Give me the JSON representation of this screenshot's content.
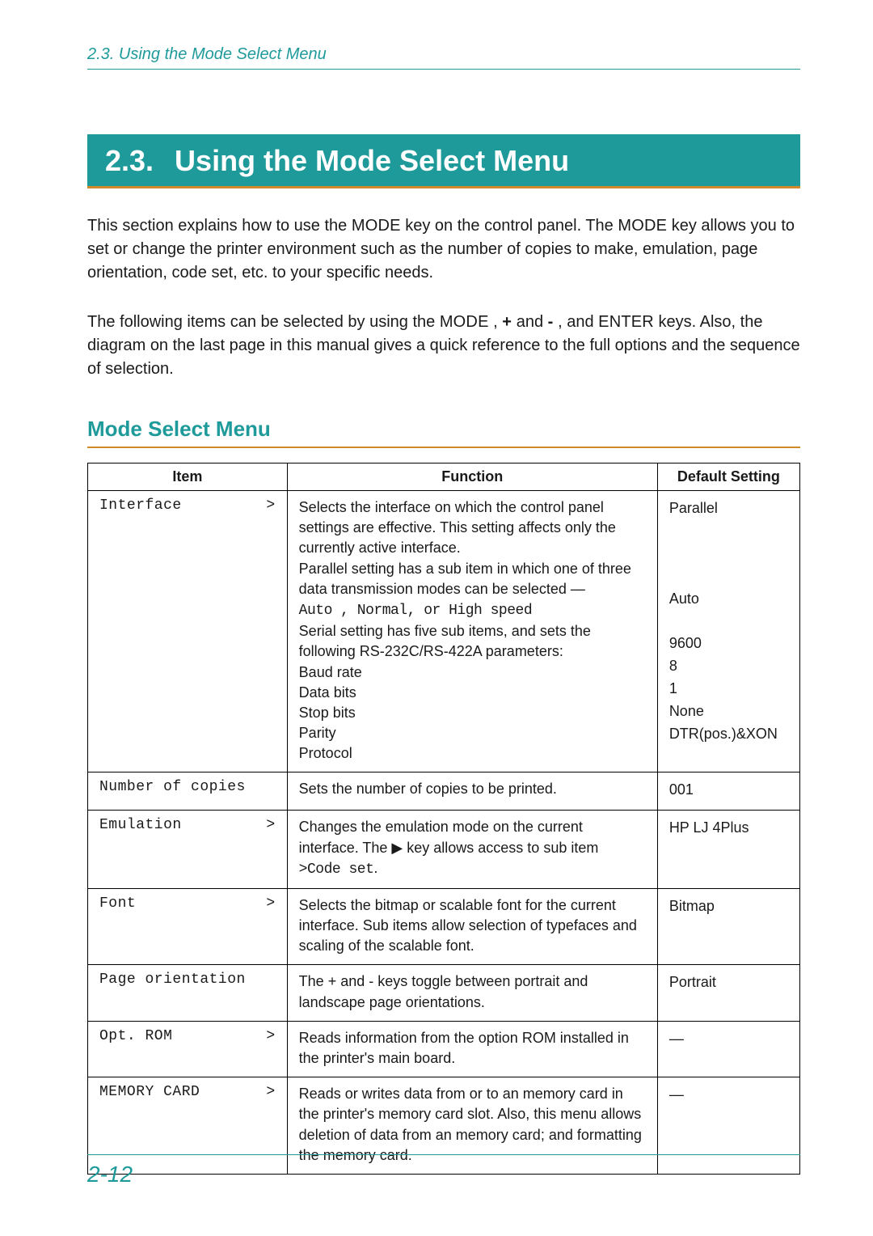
{
  "header": {
    "running_head": "2.3.  Using the Mode Select Menu"
  },
  "chapter": {
    "number": "2.3.",
    "title": "Using the Mode Select Menu"
  },
  "paragraphs": {
    "p1_a": "This section explains how to use the ",
    "p1_key1": "MODE",
    "p1_b": " key on the control panel. The ",
    "p1_key2": "MODE",
    "p1_c": " key allows you to set or change the printer environment such as the number of copies to make, emulation, page orientation, code set, etc. to your specific needs.",
    "p2_a": "The following items can be selected by using the ",
    "p2_key1": "MODE",
    "p2_b": " , ",
    "p2_key2": "+",
    "p2_c": " and ",
    "p2_key3": "-",
    "p2_d": " , and ",
    "p2_key4": "ENTER",
    "p2_e": " keys. Also, the diagram on the last page in this manual gives a quick reference to the full options and the sequence of selection."
  },
  "subheading": "Mode Select Menu",
  "table": {
    "headers": {
      "c1": "Item",
      "c2": "Function",
      "c3": "Default Setting"
    },
    "rows": [
      {
        "item": "Interface",
        "arrow": ">",
        "func_a": "Selects the interface on which the control panel settings are effective. This setting affects only the currently active interface.\nParallel setting has a sub item in which one of three data transmission modes can be selected —",
        "func_mono": "Auto , Normal, or High speed",
        "func_b": "\nSerial setting has five sub items, and sets the following RS-232C/RS-422A parameters:\nBaud rate\nData bits\nStop bits\nParity\nProtocol",
        "def": "Parallel\n\n\n\nAuto\n\n9600\n8\n1\nNone\nDTR(pos.)&XON"
      },
      {
        "item": "Number of copies",
        "arrow": "",
        "func_a": "Sets the number of copies to be printed.",
        "func_mono": "",
        "func_b": "",
        "def": "001"
      },
      {
        "item": "Emulation",
        "arrow": ">",
        "func_a": "Changes the emulation mode on the current interface. The ▶ key allows access to sub item",
        "func_mono": ">Code set",
        "func_b": ".",
        "def": "HP LJ 4Plus"
      },
      {
        "item": "Font",
        "arrow": ">",
        "func_a": "Selects the bitmap or scalable font for the current interface. Sub items allow selection of typefaces and scaling of the scalable font.",
        "func_mono": "",
        "func_b": "",
        "def": "Bitmap"
      },
      {
        "item": "Page orientation",
        "arrow": "",
        "func_a": "The + and - keys toggle between portrait and landscape page orientations.",
        "func_mono": "",
        "func_b": "",
        "def": "Portrait"
      },
      {
        "item": "Opt. ROM",
        "arrow": ">",
        "func_a": "Reads information from the option ROM installed in the printer's main board.",
        "func_mono": "",
        "func_b": "",
        "def": "—"
      },
      {
        "item": "MEMORY CARD",
        "arrow": ">",
        "func_a": "Reads or writes data from or to an memory card in the printer's memory card slot. Also, this menu allows deletion of data from an memory card; and formatting the memory card.",
        "func_mono": "",
        "func_b": "",
        "def": "—"
      }
    ]
  },
  "footer": {
    "page": "2-12"
  }
}
